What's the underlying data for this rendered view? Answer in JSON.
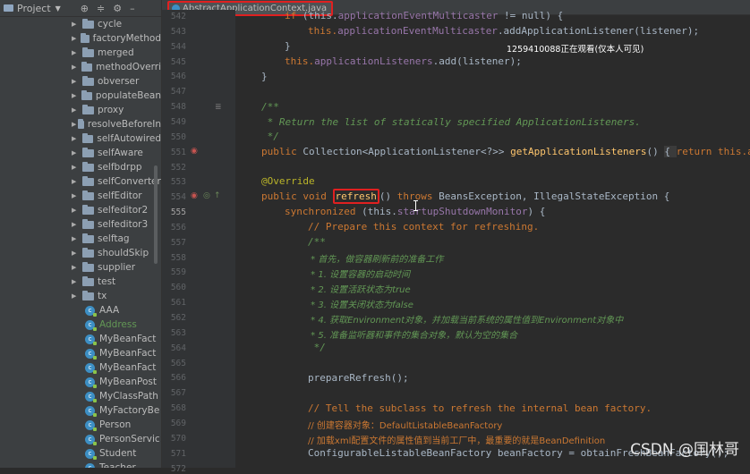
{
  "panel": {
    "title": "Project",
    "tree_folders": [
      "cycle",
      "factoryMethod",
      "merged",
      "methodOverri",
      "obverser",
      "populateBean",
      "proxy",
      "resolveBeforeIn",
      "selfAutowired",
      "selfAware",
      "selfbdrpp",
      "selfConverter",
      "selfEditor",
      "selfeditor2",
      "selfeditor3",
      "selftag",
      "shouldSkip",
      "supplier",
      "test",
      "tx"
    ],
    "tree_classes": [
      {
        "name": "AAA",
        "added": false
      },
      {
        "name": "Address",
        "added": true
      },
      {
        "name": "MyBeanFact",
        "added": false
      },
      {
        "name": "MyBeanFact",
        "added": false
      },
      {
        "name": "MyBeanFact",
        "added": false
      },
      {
        "name": "MyBeanPost",
        "added": false
      },
      {
        "name": "MyClassPath",
        "added": false
      },
      {
        "name": "MyFactoryBe",
        "added": false
      },
      {
        "name": "Person",
        "added": false
      },
      {
        "name": "PersonServic",
        "added": false
      },
      {
        "name": "Student",
        "added": false
      },
      {
        "name": "Teacher",
        "added": false
      }
    ]
  },
  "editor": {
    "tab_label": "AbstractApplicationContext.java",
    "line_numbers": [
      "542",
      "543",
      "544",
      "545",
      "546",
      "547",
      "548",
      "549",
      "550",
      "551",
      "552",
      "553",
      "554",
      "555",
      "556",
      "557",
      "558",
      "559",
      "560",
      "561",
      "562",
      "563",
      "564",
      "565",
      "566",
      "567",
      "568",
      "569",
      "570",
      "571",
      "572"
    ],
    "code": {
      "l541_if": "if",
      "l541_this": "this.",
      "l541_field": "applicationEventMulticaster",
      "l541_rest": " != null) {",
      "l542_this": "this.",
      "l542_field": "applicationEventMulticaster",
      "l542_rest": ".addApplicationListener(listener);",
      "l543": "}",
      "l544_this": "this.",
      "l544_field": "applicationListeners",
      "l544_rest": ".add(listener);",
      "l545": "}",
      "l547": "/**",
      "l548": " * Return the list of statically specified ApplicationListeners.",
      "l549": " */",
      "l550_kw": "public",
      "l550_type": " Collection<ApplicationListener<?>> ",
      "l550_fn": "getApplicationListeners",
      "l550_paren": "() ",
      "l550_brace": "{ ",
      "l550_ret": "return",
      "l550_tail": " this.app",
      "l552": "@Override",
      "l553_kw1": "public",
      "l553_kw2": " void ",
      "l553_fn": "refresh",
      "l553_paren": "() ",
      "l553_throws": "throws",
      "l553_rest": " BeansException, IllegalStateException {",
      "l554_kw": "synchronized",
      "l554_this": " (this.",
      "l554_field": "startupShutdownMonitor",
      "l554_rest": ") {",
      "l555": "// Prepare this context for refreshing.",
      "l556": "/**",
      "l557": " * 首先，做容器刷新前的准备工作",
      "l558": " * 1. 设置容器的启动时间",
      "l559": " * 2. 设置活跃状态为true",
      "l560": " * 3. 设置关闭状态为false",
      "l561": " * 4. 获取Environment对象，并加载当前系统的属性值到Environment对象中",
      "l562": " * 5. 准备监听器和事件的集合对象，默认为空的集合",
      "l563": " */",
      "l565": "prepareRefresh();",
      "l567": "// Tell the subclass to refresh the internal bean factory.",
      "l568": "// 创建容器对象：DefaultListableBeanFactory",
      "l569": "// 加载xml配置文件的属性值到当前工厂中，最重要的就是BeanDefinition",
      "l570": "ConfigurableListableBeanFactory beanFactory = obtainFreshBeanFactory();"
    }
  },
  "overlays": {
    "viewer_notice": "1259410088正在观看(仅本人可见)",
    "csdn_watermark": "CSDN @国林哥"
  }
}
